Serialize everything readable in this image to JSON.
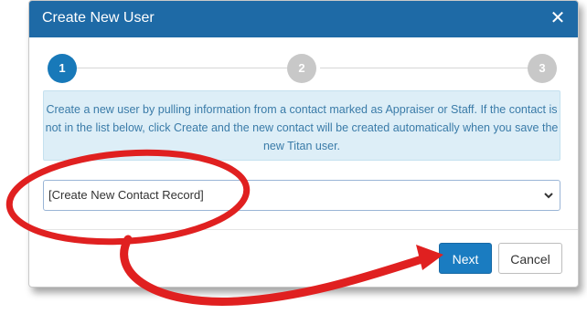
{
  "dialog": {
    "title": "Create New User",
    "close_icon": "close-icon",
    "close_glyph": "✕"
  },
  "steps": [
    {
      "label": "1",
      "state": "active"
    },
    {
      "label": "2",
      "state": "inactive"
    },
    {
      "label": "3",
      "state": "inactive"
    }
  ],
  "info": {
    "text": "Create a new user by pulling information from a contact marked as Appraiser or Staff. If the contact is not in the list below, click Create and the new contact will be created automatically when you save the new Titan user."
  },
  "contact_select": {
    "selected_value": "[Create New Contact Record]",
    "chevron_icon": "chevron-down-icon"
  },
  "footer": {
    "next_label": "Next",
    "cancel_label": "Cancel"
  },
  "colors": {
    "header": "#1e6aa6",
    "step_active": "#1879b9",
    "step_inactive": "#c8c8c8",
    "info_bg": "#ddeef7",
    "info_text": "#3a7ba8",
    "primary_button": "#1a7cc1",
    "annotation": "#e02020"
  }
}
